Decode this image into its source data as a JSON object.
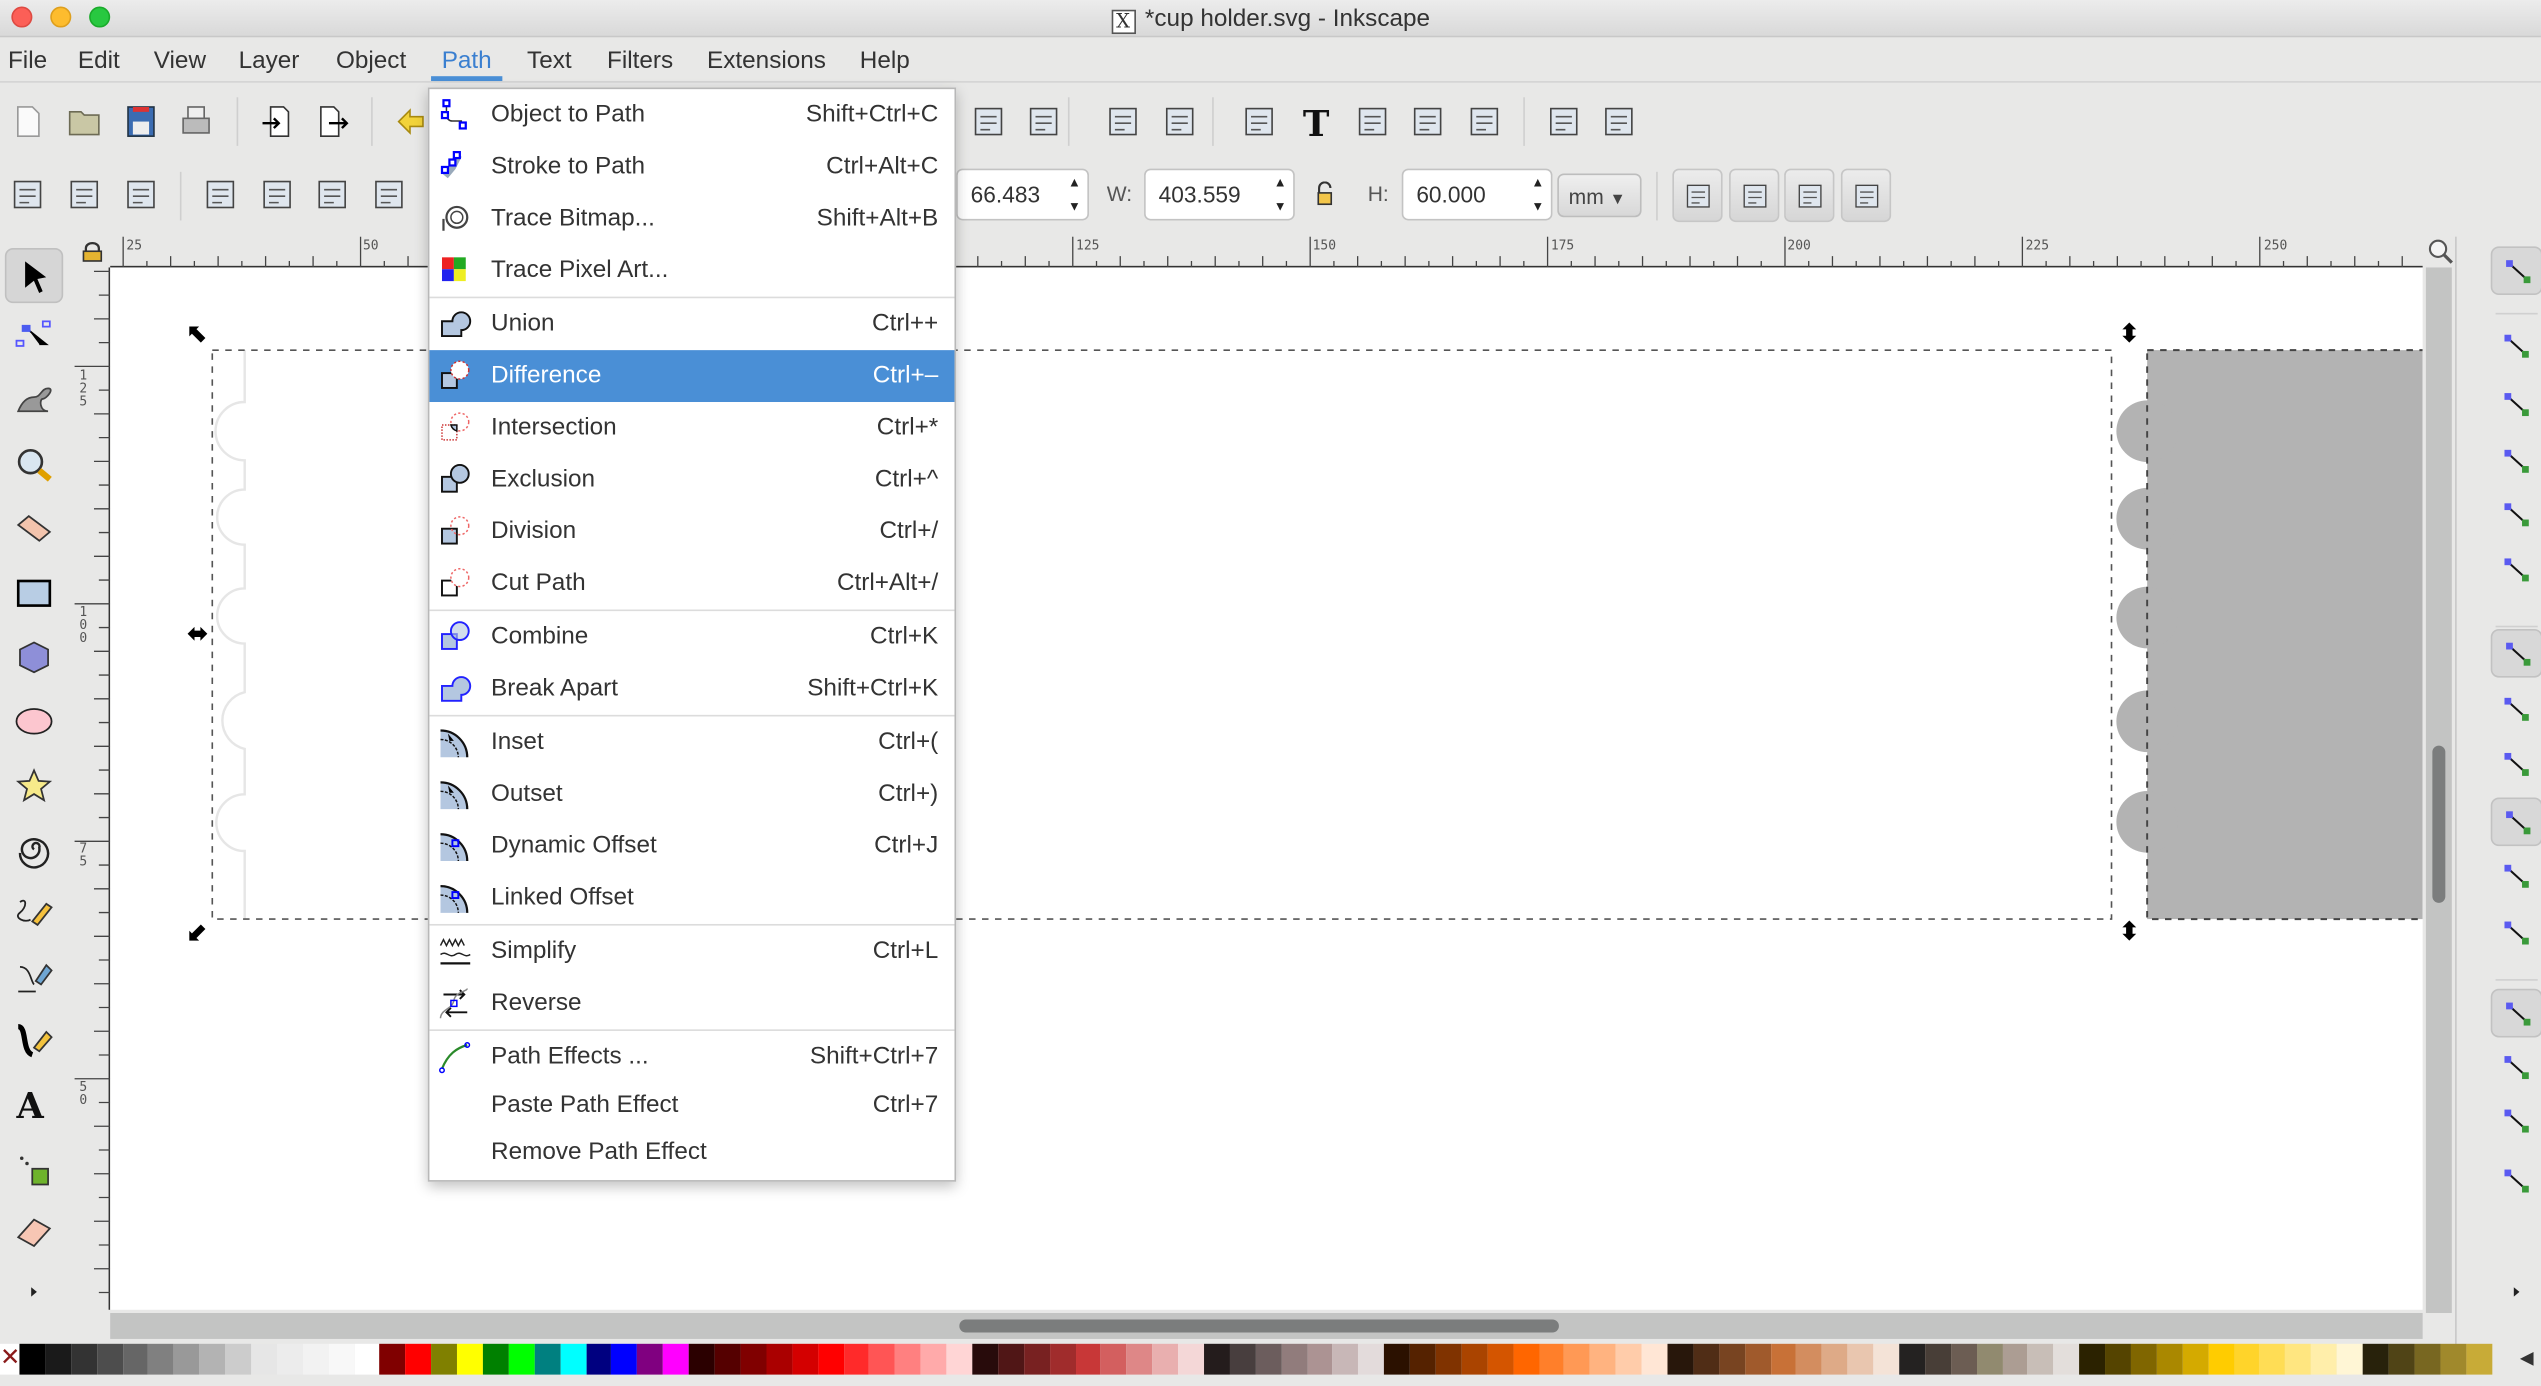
{
  "window": {
    "title": "*cup holder.svg - Inkscape",
    "title_icon": "X"
  },
  "menubar": {
    "items": [
      "File",
      "Edit",
      "View",
      "Layer",
      "Object",
      "Path",
      "Text",
      "Filters",
      "Extensions",
      "Help"
    ],
    "active": "Path"
  },
  "path_menu": {
    "items": [
      {
        "label": "Object to Path",
        "shortcut": "Shift+Ctrl+C",
        "icon": "object-to-path-icon"
      },
      {
        "label": "Stroke to Path",
        "shortcut": "Ctrl+Alt+C",
        "icon": "stroke-to-path-icon"
      },
      {
        "label": "Trace Bitmap...",
        "shortcut": "Shift+Alt+B",
        "icon": "trace-bitmap-icon"
      },
      {
        "label": "Trace Pixel Art...",
        "shortcut": "",
        "icon": "trace-pixel-art-icon"
      },
      {
        "separator": true
      },
      {
        "label": "Union",
        "shortcut": "Ctrl++",
        "icon": "union-icon"
      },
      {
        "label": "Difference",
        "shortcut": "Ctrl+–",
        "icon": "difference-icon",
        "highlighted": true
      },
      {
        "label": "Intersection",
        "shortcut": "Ctrl+*",
        "icon": "intersection-icon"
      },
      {
        "label": "Exclusion",
        "shortcut": "Ctrl+^",
        "icon": "exclusion-icon"
      },
      {
        "label": "Division",
        "shortcut": "Ctrl+/",
        "icon": "division-icon"
      },
      {
        "label": "Cut Path",
        "shortcut": "Ctrl+Alt+/",
        "icon": "cut-path-icon"
      },
      {
        "separator": true
      },
      {
        "label": "Combine",
        "shortcut": "Ctrl+K",
        "icon": "combine-icon"
      },
      {
        "label": "Break Apart",
        "shortcut": "Shift+Ctrl+K",
        "icon": "break-apart-icon"
      },
      {
        "separator": true
      },
      {
        "label": "Inset",
        "shortcut": "Ctrl+(",
        "icon": "inset-icon"
      },
      {
        "label": "Outset",
        "shortcut": "Ctrl+)",
        "icon": "outset-icon"
      },
      {
        "label": "Dynamic Offset",
        "shortcut": "Ctrl+J",
        "icon": "dynamic-offset-icon"
      },
      {
        "label": "Linked Offset",
        "shortcut": "",
        "icon": "linked-offset-icon"
      },
      {
        "separator": true
      },
      {
        "label": "Simplify",
        "shortcut": "Ctrl+L",
        "icon": "simplify-icon"
      },
      {
        "label": "Reverse",
        "shortcut": "",
        "icon": "reverse-icon"
      },
      {
        "separator": true
      },
      {
        "label": "Path Effects ...",
        "shortcut": "Shift+Ctrl+7",
        "icon": "path-effects-icon"
      },
      {
        "label": "Paste Path Effect",
        "shortcut": "Ctrl+7",
        "icon": ""
      },
      {
        "label": "Remove Path Effect",
        "shortcut": "",
        "icon": ""
      }
    ]
  },
  "toolbar": {
    "commands": [
      "new-document-icon",
      "open-icon",
      "save-icon",
      "print-icon",
      "import-icon",
      "export-icon",
      "undo-icon"
    ],
    "commands_right": [
      "lock-raise-icon",
      "lock-lower-icon",
      "group-icon",
      "ungroup-icon",
      "fill-stroke-icon",
      "text-font-icon",
      "layers-icon",
      "xml-editor-icon",
      "align-distribute-icon",
      "preferences-icon",
      "document-properties-icon"
    ]
  },
  "select_toolbar": {
    "icons": [
      "select-all-icon",
      "select-all-layers-icon",
      "deselect-icon",
      "rotate-ccw-icon",
      "rotate-cw-icon",
      "flip-horizontal-icon",
      "flip-vertical-icon"
    ],
    "x_value": "66.483",
    "w_label": "W:",
    "w_value": "403.559",
    "h_label": "H:",
    "h_value": "60.000",
    "unit": "mm",
    "transform_toggles": [
      "scale-stroke-icon",
      "scale-corners-icon",
      "transform-gradients-icon",
      "transform-patterns-icon"
    ]
  },
  "rulers": {
    "horizontal": [
      "25",
      "50",
      "125",
      "150",
      "175",
      "200",
      "225",
      "250"
    ],
    "vertical": [
      "125",
      "100",
      "75",
      "50"
    ]
  },
  "toolbox": [
    "selector-icon",
    "node-editor-icon",
    "tweak-icon",
    "zoom-icon",
    "measure-icon",
    "rectangle-icon",
    "3d-box-icon",
    "ellipse-icon",
    "star-icon",
    "spiral-icon",
    "pencil-icon",
    "pen-icon",
    "calligraphy-icon",
    "text-icon",
    "spray-icon",
    "eraser-icon",
    "more-tools-icon"
  ],
  "snap_toolbar": [
    "snap-toggle-icon",
    "snap-bbox-icon",
    "snap-bbox-edge-icon",
    "snap-bbox-corner-icon",
    "snap-bbox-midpoint-icon",
    "snap-bbox-center-icon",
    "snap-nodes-icon",
    "snap-path-icon",
    "snap-intersection-icon",
    "snap-cusp-icon",
    "snap-smooth-icon",
    "snap-line-midpoint-icon",
    "snap-others-icon",
    "snap-object-center-icon",
    "snap-rotation-center-icon",
    "snap-text-baseline-icon",
    "more-snap-icon"
  ],
  "colors": {
    "accent": "#4a8fd6",
    "selection_fill": "#b3b3b3",
    "scallop_outline": "#e6e6e6"
  },
  "palette": [
    "#000000",
    "#1a1a1a",
    "#333333",
    "#4d4d4d",
    "#666666",
    "#808080",
    "#999999",
    "#b3b3b3",
    "#cccccc",
    "#e6e6e6",
    "#ececec",
    "#f2f2f2",
    "#f8f8f8",
    "#ffffff",
    "#800000",
    "#ff0000",
    "#808000",
    "#ffff00",
    "#008000",
    "#00ff00",
    "#008080",
    "#00ffff",
    "#000080",
    "#0000ff",
    "#800080",
    "#ff00ff",
    "#2b0000",
    "#550000",
    "#800000",
    "#aa0000",
    "#d40000",
    "#ff0000",
    "#ff2a2a",
    "#ff5555",
    "#ff8080",
    "#ffaaaa",
    "#ffd5d5",
    "#280b0b",
    "#501616",
    "#782121",
    "#a02c2c",
    "#c83737",
    "#d35f5f",
    "#de8787",
    "#e9afaf",
    "#f4d7d7",
    "#241c1c",
    "#483e3e",
    "#6c5d5d",
    "#917c7c",
    "#ac9393",
    "#c8b7b7",
    "#e3dbdb",
    "#2b1100",
    "#552200",
    "#803300",
    "#aa4400",
    "#d45500",
    "#ff6600",
    "#ff7f2a",
    "#ff9955",
    "#ffb380",
    "#ffccaa",
    "#ffe6d5",
    "#28170b",
    "#502d16",
    "#784421",
    "#a05a2c",
    "#c87137",
    "#d38d5f",
    "#deaa87",
    "#e9c6af",
    "#f4e3d7",
    "#242221",
    "#483e37",
    "#6c5d53",
    "#918a6f",
    "#ac9d93",
    "#c8beb7",
    "#e3dedb",
    "#2b2200",
    "#554400",
    "#806600",
    "#aa8800",
    "#d4aa00",
    "#ffcc00",
    "#ffd42a",
    "#ffdd55",
    "#ffe680",
    "#ffeeaa",
    "#fff6d5",
    "#28220b",
    "#504416",
    "#786721",
    "#a0892c",
    "#c8ab37"
  ]
}
